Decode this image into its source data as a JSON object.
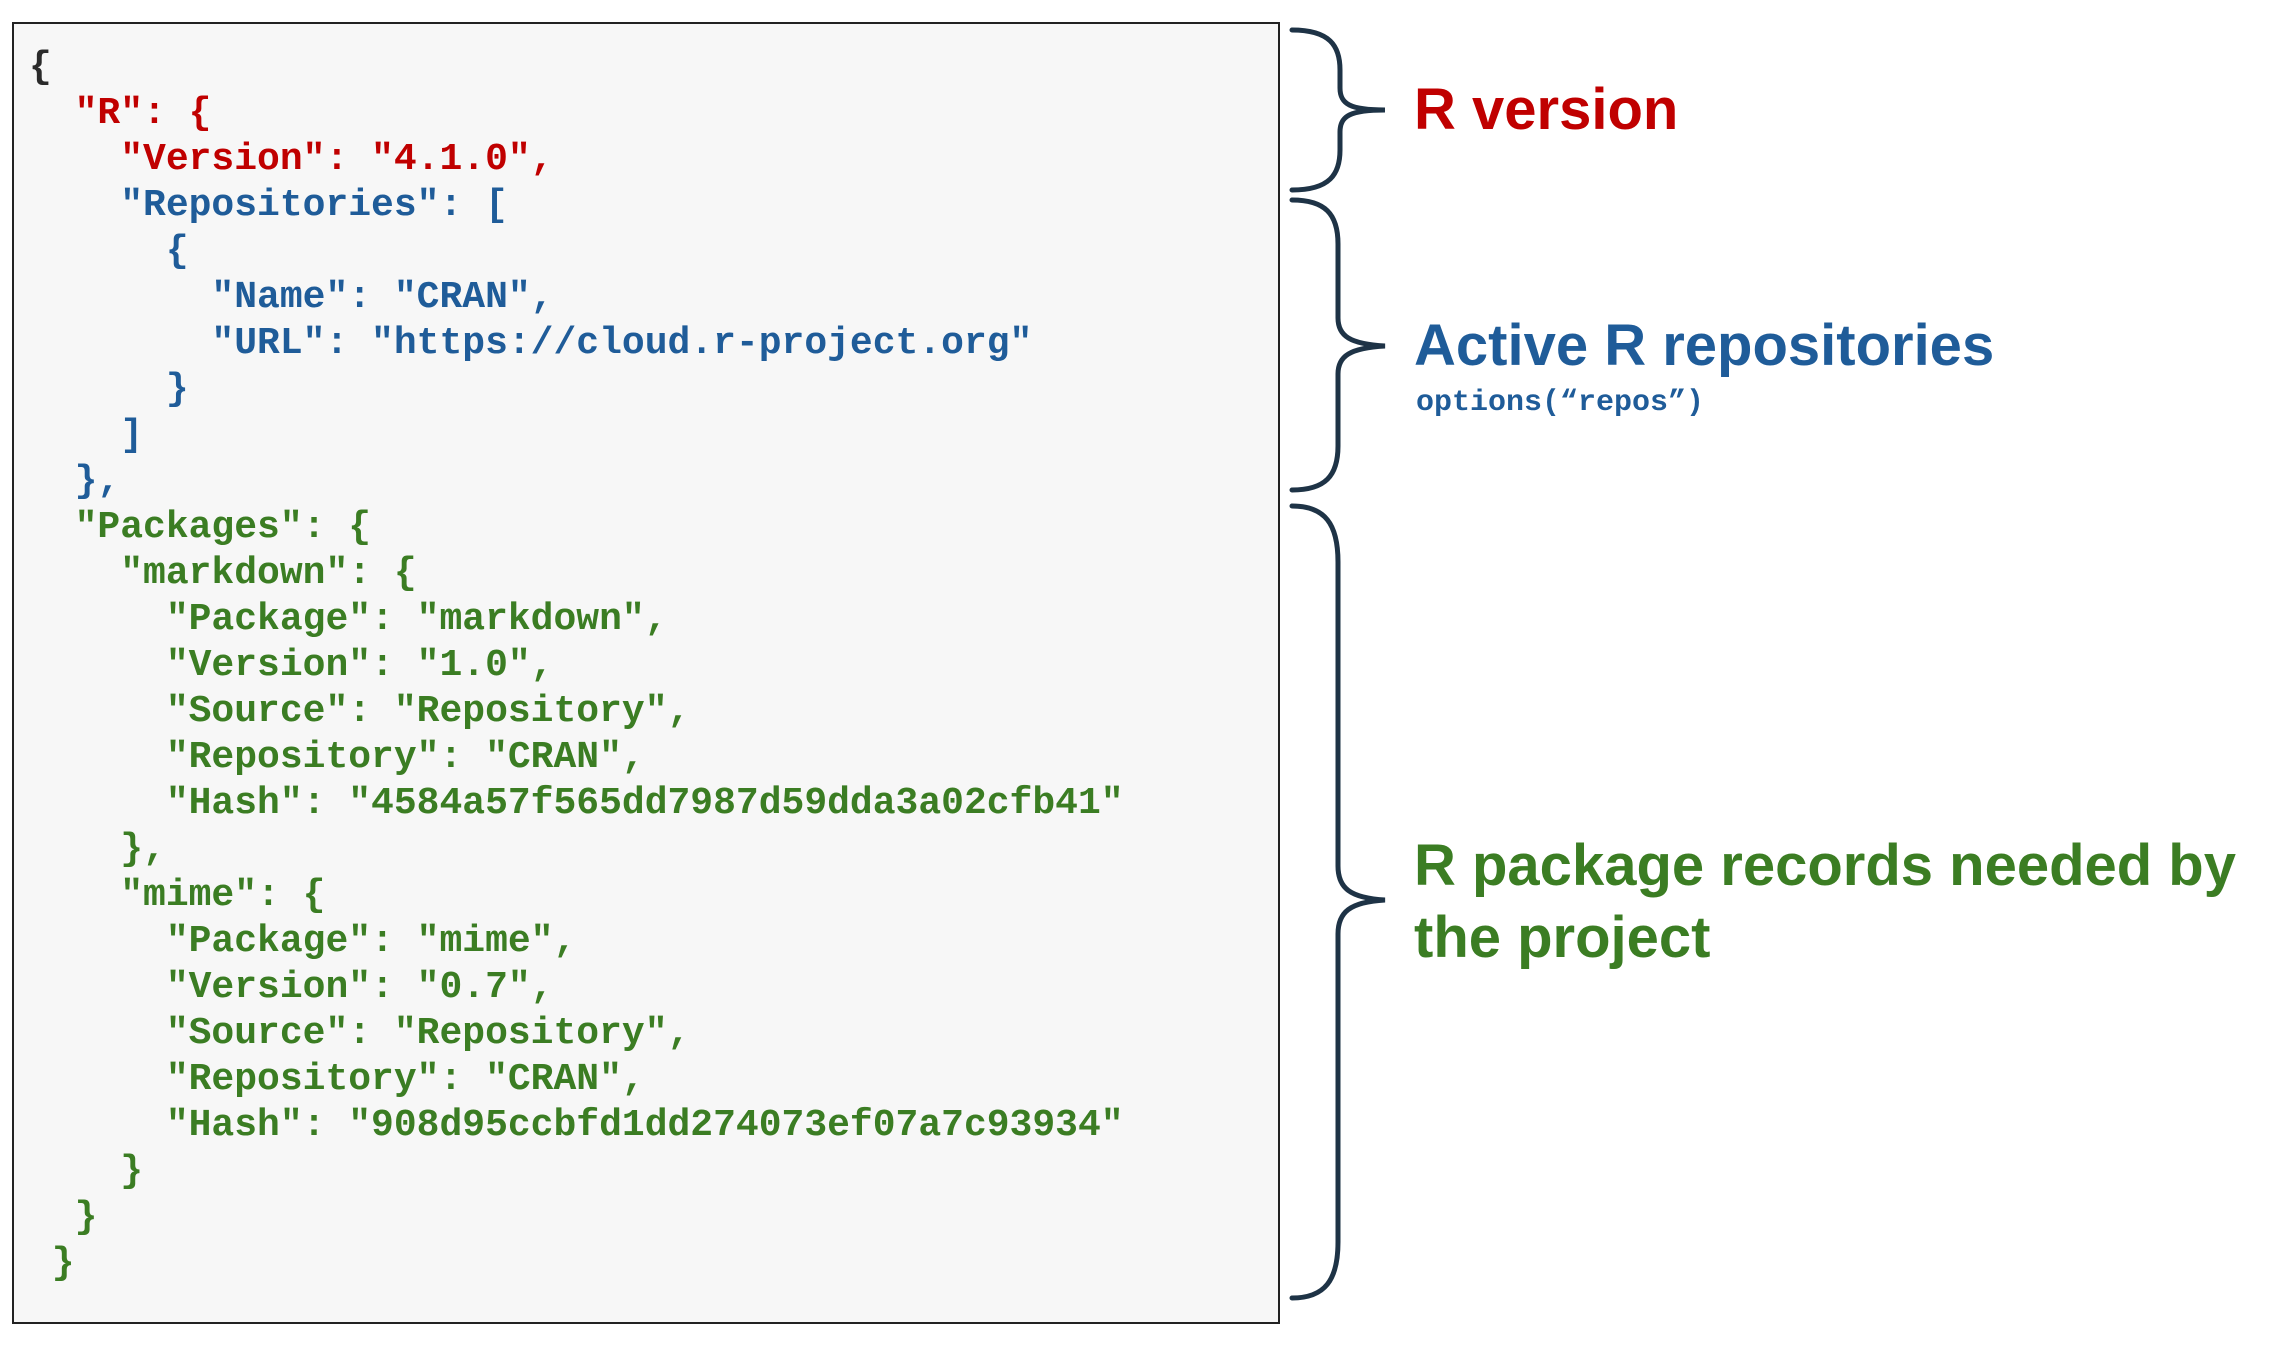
{
  "code_lines": [
    {
      "text": "{",
      "color": "black"
    },
    {
      "text": "  \"R\": {",
      "color": "red"
    },
    {
      "text": "    \"Version\": \"4.1.0\",",
      "color": "red"
    },
    {
      "text": "    \"Repositories\": [",
      "color": "blue"
    },
    {
      "text": "      {",
      "color": "blue"
    },
    {
      "text": "        \"Name\": \"CRAN\",",
      "color": "blue"
    },
    {
      "text": "        \"URL\": \"https://cloud.r-project.org\"",
      "color": "blue"
    },
    {
      "text": "      }",
      "color": "blue"
    },
    {
      "text": "    ]",
      "color": "blue"
    },
    {
      "text": "  },",
      "color": "blue"
    },
    {
      "text": "  \"Packages\": {",
      "color": "green"
    },
    {
      "text": "    \"markdown\": {",
      "color": "green"
    },
    {
      "text": "      \"Package\": \"markdown\",",
      "color": "green"
    },
    {
      "text": "      \"Version\": \"1.0\",",
      "color": "green"
    },
    {
      "text": "      \"Source\": \"Repository\",",
      "color": "green"
    },
    {
      "text": "      \"Repository\": \"CRAN\",",
      "color": "green"
    },
    {
      "text": "      \"Hash\": \"4584a57f565dd7987d59dda3a02cfb41\"",
      "color": "green"
    },
    {
      "text": "    },",
      "color": "green"
    },
    {
      "text": "    \"mime\": {",
      "color": "green"
    },
    {
      "text": "      \"Package\": \"mime\",",
      "color": "green"
    },
    {
      "text": "      \"Version\": \"0.7\",",
      "color": "green"
    },
    {
      "text": "      \"Source\": \"Repository\",",
      "color": "green"
    },
    {
      "text": "      \"Repository\": \"CRAN\",",
      "color": "green"
    },
    {
      "text": "      \"Hash\": \"908d95ccbfd1dd274073ef07a7c93934\"",
      "color": "green"
    },
    {
      "text": "    }",
      "color": "green"
    },
    {
      "text": "  }",
      "color": "green"
    },
    {
      "text": " }",
      "color": "green"
    }
  ],
  "annotations": {
    "r_version": {
      "label": "R version",
      "color": "#c00000"
    },
    "repositories": {
      "label": "Active R repositories",
      "sub": "options(“repos”)",
      "color": "#1f5c99"
    },
    "packages": {
      "line1": "R package records needed by",
      "line2": "the project",
      "color": "#3b7d23"
    }
  },
  "colors": {
    "black": "#2b2b2b",
    "red": "#c00000",
    "blue": "#1f5c99",
    "green": "#3b7d23",
    "brace": "#1e3346",
    "code_background": "#f7f7f7"
  }
}
